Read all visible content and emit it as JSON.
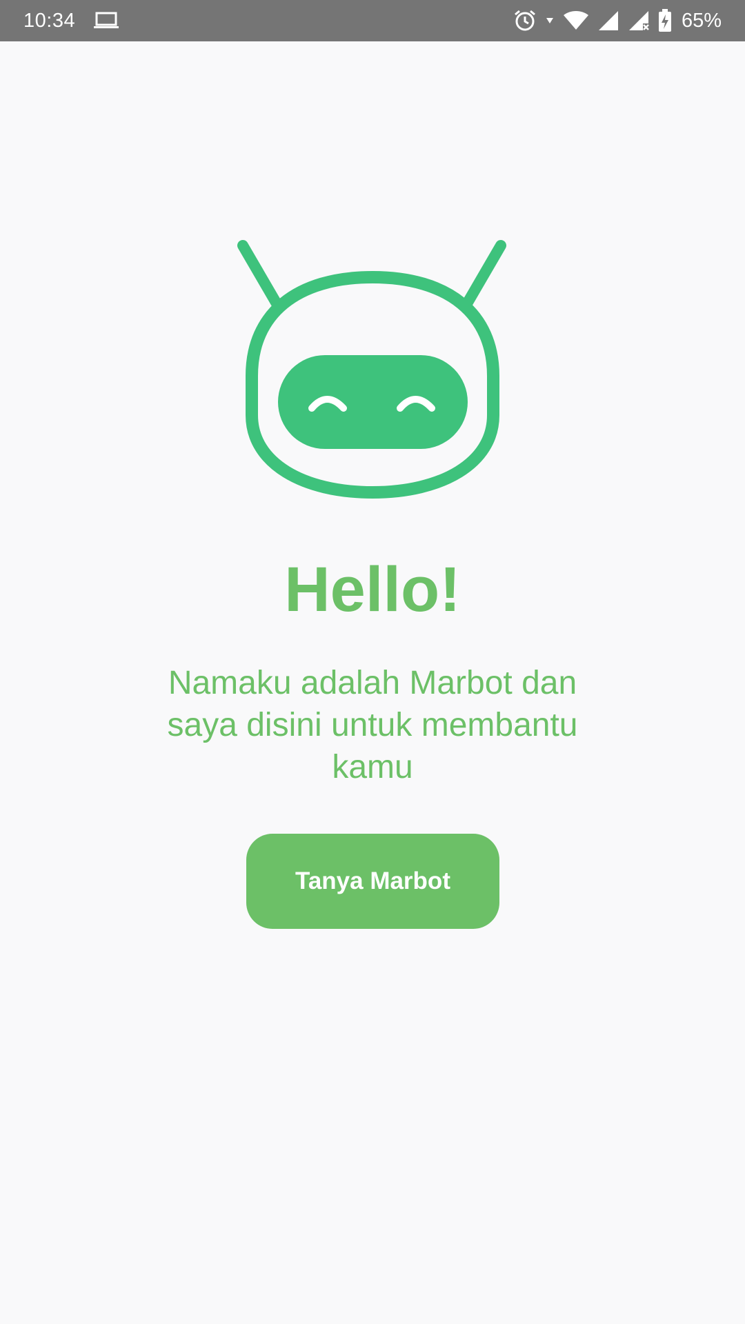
{
  "status_bar": {
    "time": "10:34",
    "battery": "65%",
    "icons": [
      "laptop-icon",
      "alarm-icon",
      "data-arrow-icon",
      "wifi-icon",
      "signal-icon",
      "signal-no-service-icon",
      "battery-charging-icon"
    ]
  },
  "main": {
    "logo_icon": "robot-icon",
    "title": "Hello!",
    "subtitle": "Namaku adalah Marbot dan saya disini untuk membantu kamu",
    "button_label": "Tanya Marbot"
  },
  "colors": {
    "accent": "#6cc067",
    "logo": "#3ec27c",
    "background": "#f9f9fa",
    "status_bar": "#757575"
  }
}
